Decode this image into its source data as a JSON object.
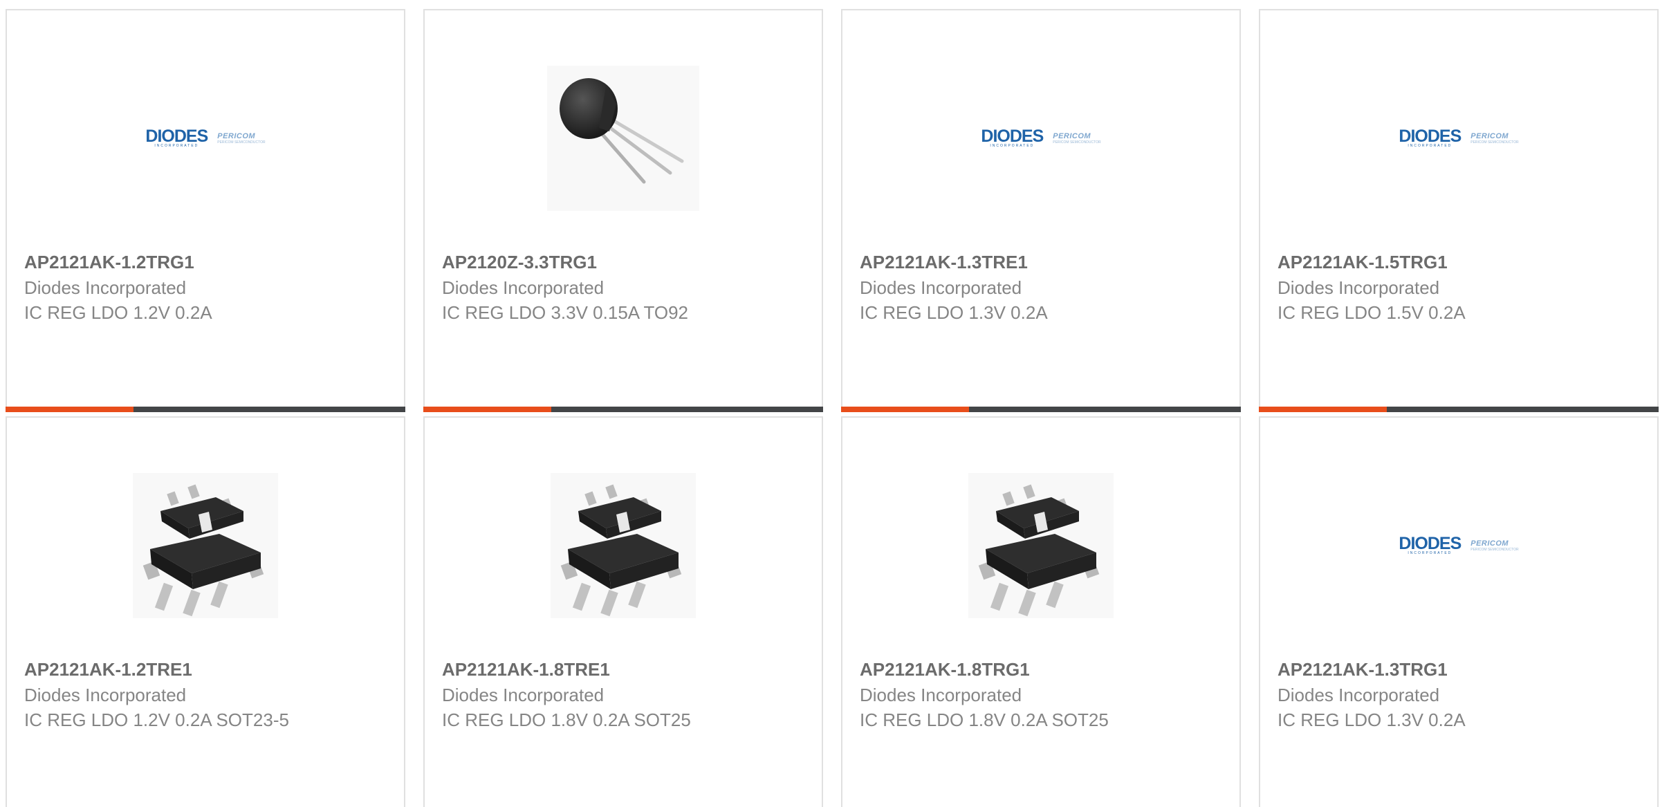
{
  "logo": {
    "brand": "DIODES",
    "brand_sub": "INCORPORATED",
    "partner": "PERICOM",
    "partner_sub": "PERICOM SEMICONDUCTOR"
  },
  "colors": {
    "accent": "#e84e1b",
    "bar": "#434547",
    "title_text": "#6b6b6b",
    "body_text": "#858585",
    "logo_blue": "#1f63a8"
  },
  "products": [
    {
      "part": "AP2121AK-1.2TRG1",
      "manufacturer": "Diodes Incorporated",
      "description": "IC REG LDO 1.2V 0.2A",
      "image": "diodes-logo"
    },
    {
      "part": "AP2120Z-3.3TRG1",
      "manufacturer": "Diodes Incorporated",
      "description": "IC REG LDO 3.3V 0.15A TO92",
      "image": "to92-package"
    },
    {
      "part": "AP2121AK-1.3TRE1",
      "manufacturer": "Diodes Incorporated",
      "description": "IC REG LDO 1.3V 0.2A",
      "image": "diodes-logo"
    },
    {
      "part": "AP2121AK-1.5TRG1",
      "manufacturer": "Diodes Incorporated",
      "description": "IC REG LDO 1.5V 0.2A",
      "image": "diodes-logo"
    },
    {
      "part": "AP2121AK-1.2TRE1",
      "manufacturer": "Diodes Incorporated",
      "description": "IC REG LDO 1.2V 0.2A SOT23-5",
      "image": "sot23-package"
    },
    {
      "part": "AP2121AK-1.8TRE1",
      "manufacturer": "Diodes Incorporated",
      "description": "IC REG LDO 1.8V 0.2A SOT25",
      "image": "sot23-package"
    },
    {
      "part": "AP2121AK-1.8TRG1",
      "manufacturer": "Diodes Incorporated",
      "description": "IC REG LDO 1.8V 0.2A SOT25",
      "image": "sot23-package"
    },
    {
      "part": "AP2121AK-1.3TRG1",
      "manufacturer": "Diodes Incorporated",
      "description": "IC REG LDO 1.3V 0.2A",
      "image": "diodes-logo"
    }
  ]
}
